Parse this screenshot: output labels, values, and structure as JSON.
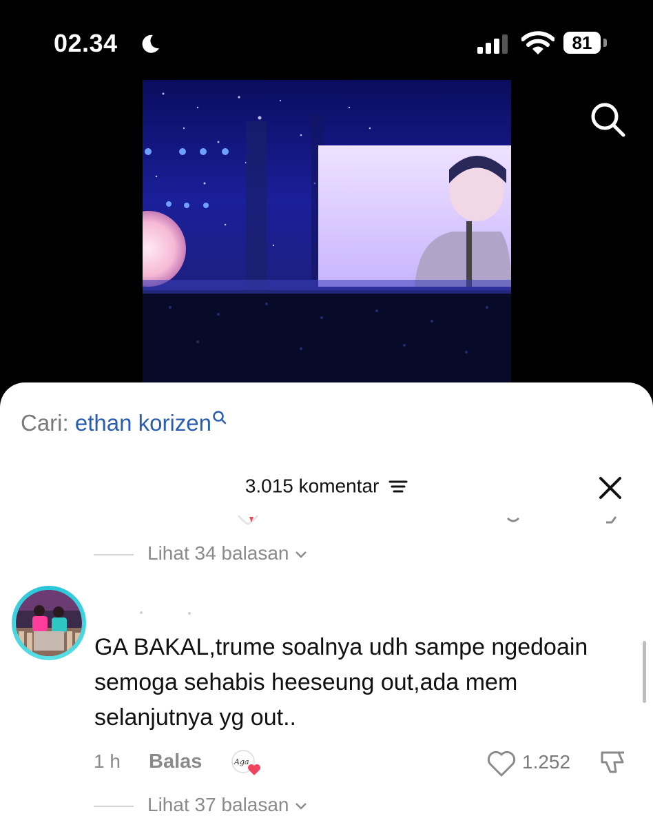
{
  "status_bar": {
    "time": "02.34",
    "battery": "81",
    "icons": [
      "moon-icon",
      "signal-icon",
      "wifi-icon",
      "battery-icon"
    ]
  },
  "video": {
    "description_icons": [
      "search-icon"
    ]
  },
  "search_suggestion": {
    "label": "Cari:",
    "query": "ethan korizen"
  },
  "comments_header": {
    "count_label": "3.015 komentar"
  },
  "view_replies_top": "Lihat 34 balasan",
  "comment": {
    "text": "GA BAKAL,trume soalnya udh sampe ngedoain semoga sehabis heeseung out,ada mem selanjutnya yg out..",
    "time": "1 h",
    "reply_label": "Balas",
    "sticker_text": "Aga",
    "like_count": "1.252"
  },
  "view_replies_bottom": "Lihat 37 balasan",
  "colors": {
    "accent_link": "#2a5db0",
    "avatar_ring": "#27c6d8",
    "muted_text": "#8a8a8a"
  }
}
